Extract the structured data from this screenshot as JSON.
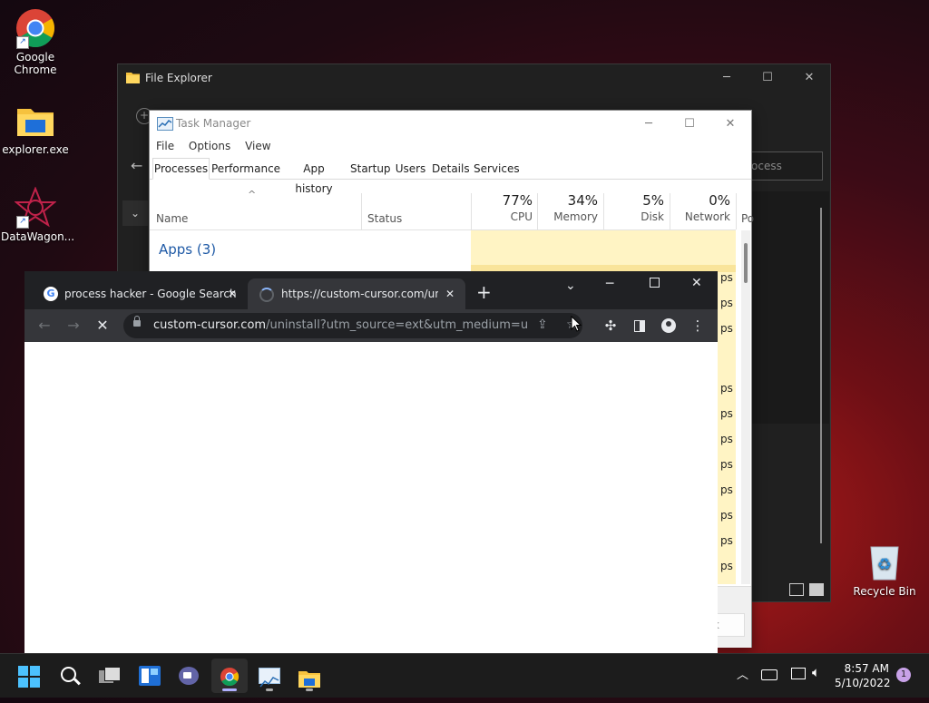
{
  "desktop": {
    "icons": [
      {
        "label": "Google Chrome",
        "icon": "chrome-icon"
      },
      {
        "label": "explorer.exe",
        "icon": "folder-icon"
      },
      {
        "label": "DataWagon...",
        "icon": "datawagon-icon"
      },
      {
        "label": "Recycle Bin",
        "icon": "recycle-bin-icon"
      }
    ]
  },
  "file_explorer": {
    "title": "File Explorer",
    "search_placeholder_fragment": "ocess"
  },
  "task_manager": {
    "title": "Task Manager",
    "menu": [
      "File",
      "Options",
      "View"
    ],
    "tabs": [
      "Processes",
      "Performance",
      "App history",
      "Startup",
      "Users",
      "Details",
      "Services"
    ],
    "active_tab": "Processes",
    "columns": {
      "name": "Name",
      "status": "Status",
      "cpu": {
        "pct": "77%",
        "label": "CPU"
      },
      "memory": {
        "pct": "34%",
        "label": "Memory"
      },
      "disk": {
        "pct": "5%",
        "label": "Disk"
      },
      "network": {
        "pct": "0%",
        "label": "Network"
      },
      "power": "Po"
    },
    "group_apps": "Apps (3)",
    "row_fragment": "ps",
    "footer_fragment": "k"
  },
  "chrome": {
    "tabs": [
      {
        "title": "process hacker - Google Search",
        "icon": "google-icon"
      },
      {
        "title": "https://custom-cursor.com/unins",
        "icon": "loading-spinner-icon"
      }
    ],
    "url_domain": "custom-cursor.com",
    "url_path": "/uninstall?utm_source=ext&utm_medium=un..."
  },
  "taskbar": {
    "time": "8:57 AM",
    "date": "5/10/2022",
    "notification_count": "1"
  }
}
